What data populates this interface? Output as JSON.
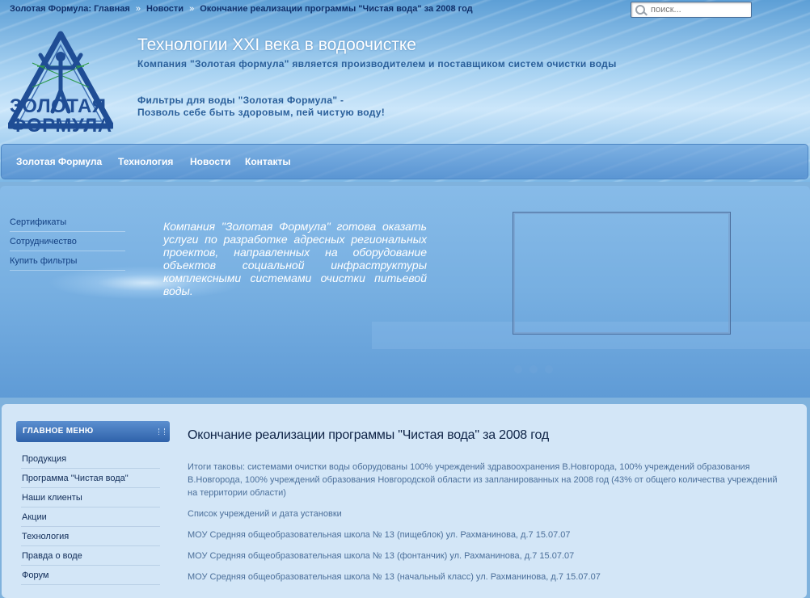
{
  "breadcrumb": {
    "items": [
      "Золотая Формула: Главная",
      "Новости",
      "Окончание реализации программы \"Чистая вода\" за 2008 год"
    ],
    "separator": "»"
  },
  "search": {
    "placeholder": "поиск..."
  },
  "logo": {
    "text_line1": "ЗОЛОТАЯ",
    "text_line2": "ФОРМУЛА"
  },
  "header": {
    "title": "Технологии XXI века в водоочистке",
    "subtitle": "Компания \"Золотая формула\" является производителем и поставщиком систем очистки воды",
    "slogan_line1": "Фильтры для воды \"Золотая Формула\" -",
    "slogan_line2": "Позволь себе быть здоровым, пей чистую воду!"
  },
  "nav": {
    "items": [
      "Золотая Формула",
      "Технология",
      "Новости",
      "Контакты"
    ]
  },
  "showcase": {
    "side_links": [
      "Сертификаты",
      "Сотрудничество",
      "Купить фильтры"
    ],
    "text": "Компания \"Золотая Формула\" готова оказать услуги по разработке адресных региональных проектов, направленных на оборудование объектов социальной инфраструктуры комплексными системами очистки питьевой воды.",
    "dots_count": 3
  },
  "main_menu": {
    "header": "ГЛАВНОЕ МЕНЮ",
    "items": [
      "Продукция",
      "Программа \"Чистая вода\"",
      "Наши клиенты",
      "Акции",
      "Технология",
      "Правда о воде",
      "Форум"
    ]
  },
  "article": {
    "title": "Окончание реализации программы \"Чистая вода\" за 2008 год",
    "paragraphs": [
      "Итоги таковы: системами очистки воды оборудованы 100% учреждений здравоохранения В.Новгорода, 100% учреждений образования В.Новгорода, 100% учреждений образования Новгородской области из запланированных на 2008 год (43% от общего количества учреждений на территории области)",
      "Список учреждений и дата установки",
      "МОУ Средняя общеобразовательная школа № 13 (пищеблок) ул. Рахманинова, д.7 15.07.07",
      "МОУ Средняя общеобразовательная школа № 13 (фонтанчик) ул. Рахманинова, д.7 15.07.07",
      "МОУ Средняя общеобразовательная школа № 13 (начальный класс) ул. Рахманинова, д.7 15.07.07"
    ]
  },
  "colors": {
    "header_blue": "#5d9fd6",
    "link_dark": "#0f2f6a",
    "logo_blue": "#1f4d95",
    "logo_green": "#2e9a4c",
    "main_bg": "#d3e6f7",
    "menu_header": "#2f62aa",
    "article_text": "#4b6f9a"
  },
  "icons": {
    "search": "search-icon",
    "menu_grip": "grip-icon"
  }
}
